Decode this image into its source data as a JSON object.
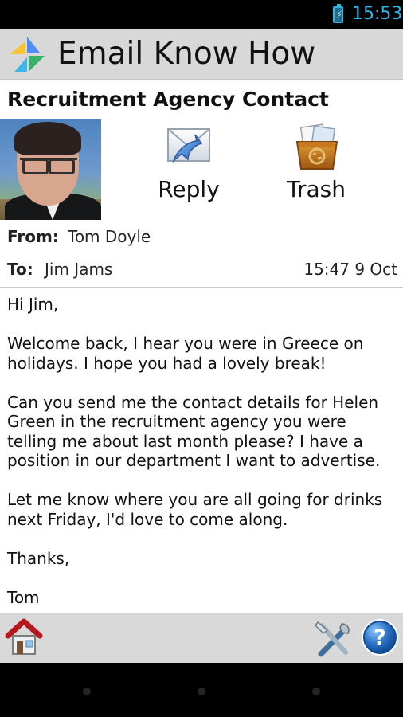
{
  "status_bar": {
    "time": "15:53",
    "icons": [
      "battery-charging-icon"
    ],
    "accent": "#33b5e5"
  },
  "app": {
    "title": "Email Know How",
    "logo": "email-know-how-logo",
    "appbar_color": "#d8d8d8"
  },
  "email": {
    "subject": "Recruitment Agency Contact",
    "from_label": "From:",
    "from": "Tom Doyle",
    "to_label": "To:",
    "to": "Jim Jams",
    "date": "15:47 9 Oct",
    "body": [
      "Hi Jim,",
      "Welcome back, I hear you were in Greece on holidays. I hope you had a lovely break!",
      "Can you send me the contact details for Helen Green in the recruitment agency you were telling me about last month please? I have a position in our department I want to advertise.",
      "Let me know where you are all going for drinks next Friday, I'd love to come along.",
      "Thanks,",
      "Tom"
    ]
  },
  "actions": {
    "reply_label": "Reply",
    "trash_label": "Trash",
    "reply_icon": "reply-envelope-icon",
    "trash_icon": "trash-box-icon"
  },
  "footer": {
    "icons": [
      "home-icon",
      "tools-icon",
      "help-icon"
    ]
  },
  "system_nav": {
    "buttons": [
      "back-button",
      "home-nav-button",
      "recents-button"
    ]
  }
}
